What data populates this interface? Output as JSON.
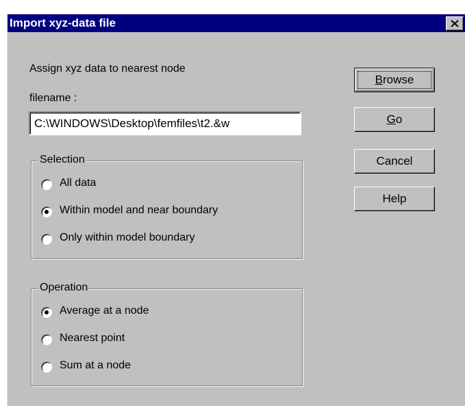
{
  "window": {
    "title": "Import xyz-data file"
  },
  "form": {
    "description": "Assign xyz data to nearest node",
    "filename_label": "filename :",
    "filename_value": "C:\\WINDOWS\\Desktop\\femfiles\\t2.&w"
  },
  "selection": {
    "label": "Selection",
    "options": [
      {
        "label": "All data",
        "checked": false
      },
      {
        "label": "Within model and near boundary",
        "checked": true
      },
      {
        "label": "Only within model boundary",
        "checked": false
      }
    ]
  },
  "operation": {
    "label": "Operation",
    "options": [
      {
        "label": "Average at a node",
        "checked": true
      },
      {
        "label": "Nearest point",
        "checked": false
      },
      {
        "label": "Sum at a node",
        "checked": false
      }
    ]
  },
  "buttons": {
    "browse": {
      "mnemonic": "B",
      "rest": "rowse"
    },
    "go": {
      "mnemonic": "G",
      "rest": "o"
    },
    "cancel": "Cancel",
    "help": "Help"
  },
  "icons": {
    "close": "close-icon"
  },
  "colors": {
    "titlebar": "#000080",
    "face": "#c0c0c0"
  }
}
